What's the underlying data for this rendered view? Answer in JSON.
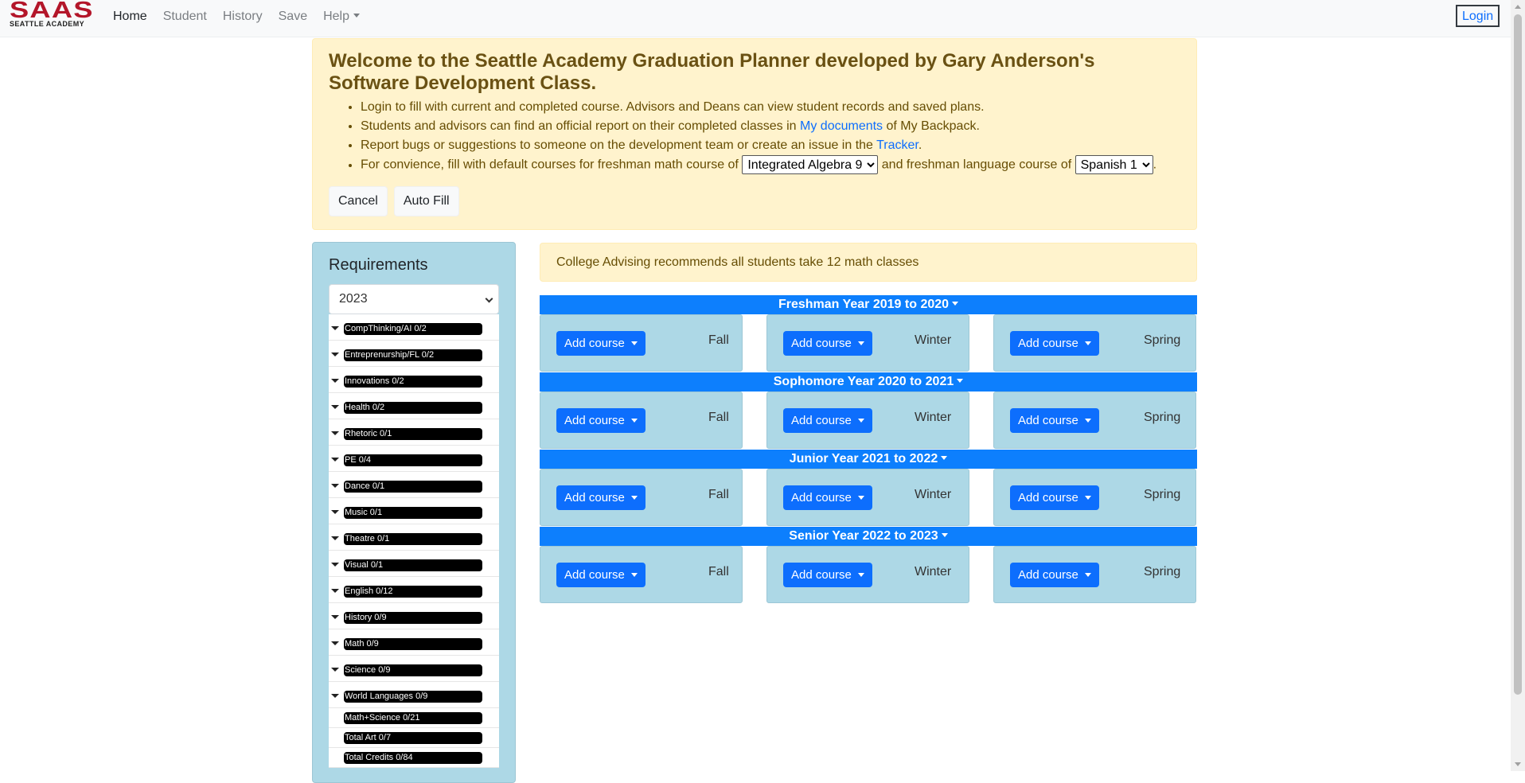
{
  "brand": {
    "name_top": "SAAS",
    "name_bottom": "SEATTLE ACADEMY"
  },
  "nav": {
    "items": [
      {
        "label": "Home",
        "active": true
      },
      {
        "label": "Student"
      },
      {
        "label": "History"
      },
      {
        "label": "Save"
      },
      {
        "label": "Help",
        "dropdown": true
      }
    ],
    "login_label": "Login"
  },
  "welcome": {
    "title": "Welcome to the Seattle Academy Graduation Planner developed by Gary Anderson's Software Development Class.",
    "bullet1": "Login to fill with current and completed course. Advisors and Deans can view student records and saved plans.",
    "bullet2_pre": "Students and advisors can find an official report on their completed classes in ",
    "bullet2_link": "My documents",
    "bullet2_post": " of My Backpack.",
    "bullet3_pre": "Report bugs or suggestions to someone on the development team or create an issue in the ",
    "bullet3_link": "Tracker",
    "bullet3_post": ".",
    "bullet4_pre": "For convience, fill with default courses for freshman math course of ",
    "math_selected": "Integrated Algebra 9",
    "bullet4_mid": " and freshman language course of ",
    "language_selected": "Spanish 1",
    "bullet4_post": ".",
    "cancel_label": "Cancel",
    "autofill_label": "Auto Fill"
  },
  "requirements": {
    "title": "Requirements",
    "year_selected": "2023",
    "items": [
      "CompThinking/AI 0/2",
      "Entreprenurship/FL 0/2",
      "Innovations 0/2",
      "Health 0/2",
      "Rhetoric 0/1",
      "PE 0/4",
      "Dance 0/1",
      "Music 0/1",
      "Theatre 0/1",
      "Visual 0/1",
      "English 0/12",
      "History 0/9",
      "Math 0/9",
      "Science 0/9",
      "World Languages 0/9"
    ],
    "totals": [
      "Math+Science 0/21",
      "Total Art 0/7",
      "Total Credits 0/84"
    ]
  },
  "advice": "College Advising recommends all students take 12 math classes",
  "years": [
    {
      "label": "Freshman Year 2019 to 2020"
    },
    {
      "label": "Sophomore Year 2020 to 2021"
    },
    {
      "label": "Junior Year 2021 to 2022"
    },
    {
      "label": "Senior Year 2022 to 2023"
    }
  ],
  "terms": [
    "Fall",
    "Winter",
    "Spring"
  ],
  "add_course_label": "Add course"
}
